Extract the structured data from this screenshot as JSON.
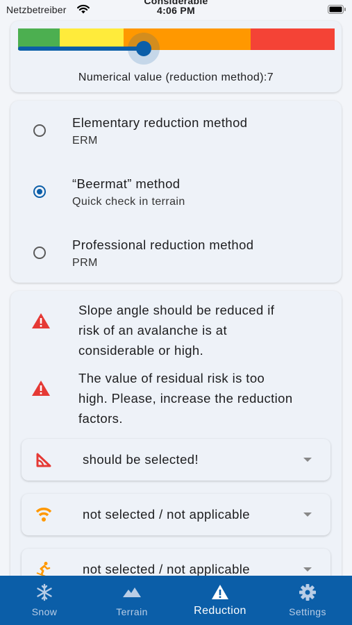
{
  "status_bar": {
    "carrier": "Netzbetreiber",
    "title": "Considerable",
    "time": "4:06 PM"
  },
  "slider": {
    "value": 7,
    "label": "Numerical value (reduction method):7",
    "segment_colors": [
      "#4caf50",
      "#ffeb3b",
      "#ff9800",
      "#f44336"
    ],
    "accent": "#0b5ea8"
  },
  "methods": [
    {
      "title": "Elementary reduction method",
      "subtitle": "ERM",
      "selected": false
    },
    {
      "title": "“Beermat” method",
      "subtitle": "Quick check in terrain",
      "selected": true
    },
    {
      "title": "Professional reduction method",
      "subtitle": "PRM",
      "selected": false
    }
  ],
  "warnings": [
    {
      "icon": "warning-icon",
      "lines": [
        "Slope angle should be reduced if",
        "risk of an avalanche is at",
        "considerable or high."
      ]
    },
    {
      "icon": "warning-icon",
      "lines": [
        "The value of residual risk is too",
        "high. Please, increase the reduction",
        "factors."
      ]
    }
  ],
  "dropdowns": [
    {
      "icon": "slope-angle-icon",
      "value": "should be selected!"
    },
    {
      "icon": "signal-icon",
      "value": "not selected / not applicable"
    },
    {
      "icon": "skier-icon",
      "value": "not selected / not applicable"
    }
  ],
  "nav": {
    "items": [
      {
        "label": "Snow",
        "icon": "snowflake-icon",
        "active": false
      },
      {
        "label": "Terrain",
        "icon": "mountain-icon",
        "active": false
      },
      {
        "label": "Reduction",
        "icon": "warning-icon",
        "active": true
      },
      {
        "label": "Settings",
        "icon": "gear-icon",
        "active": false
      }
    ]
  },
  "colors": {
    "warning": "#e53935",
    "orange": "#ff9800",
    "nav_background": "#0b5ea8"
  }
}
